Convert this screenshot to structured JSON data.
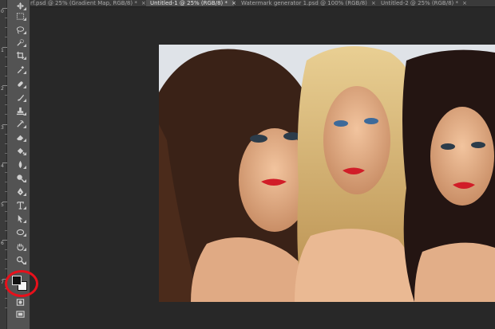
{
  "tabs": [
    {
      "label": "rf.psd @ 25% (Gradient Map, RGB/8) *",
      "close": "×",
      "active": false
    },
    {
      "label": "Untitled-1 @ 25% (RGB/8) *",
      "close": "×",
      "active": true
    },
    {
      "label": "Watermark generator 1.psd @ 100% (RGB/8)",
      "close": "×",
      "active": false
    },
    {
      "label": "Untitled-2 @ 25% (RGB/8) *",
      "close": "×",
      "active": false
    }
  ],
  "ruler": {
    "labels": [
      "0",
      "1",
      "2",
      "3",
      "4",
      "5",
      "6",
      "7"
    ]
  },
  "toolbar": {
    "tools": [
      "move-tool-icon",
      "marquee-tool-icon",
      "lasso-tool-icon",
      "quick-selection-tool-icon",
      "crop-tool-icon",
      "eyedropper-tool-icon",
      "spot-healing-brush-icon",
      "brush-tool-icon",
      "clone-stamp-icon",
      "history-brush-icon",
      "eraser-tool-icon",
      "paint-bucket-icon",
      "blur-tool-icon",
      "dodge-tool-icon",
      "pen-tool-icon",
      "type-tool-icon",
      "path-selection-icon",
      "ellipse-tool-icon",
      "hand-tool-icon",
      "zoom-tool-icon"
    ],
    "foreground_color": "#111111",
    "background_color": "#f5f5f5",
    "highlight_color": "#e8101b"
  },
  "canvas": {
    "content": "photo-three-women"
  }
}
